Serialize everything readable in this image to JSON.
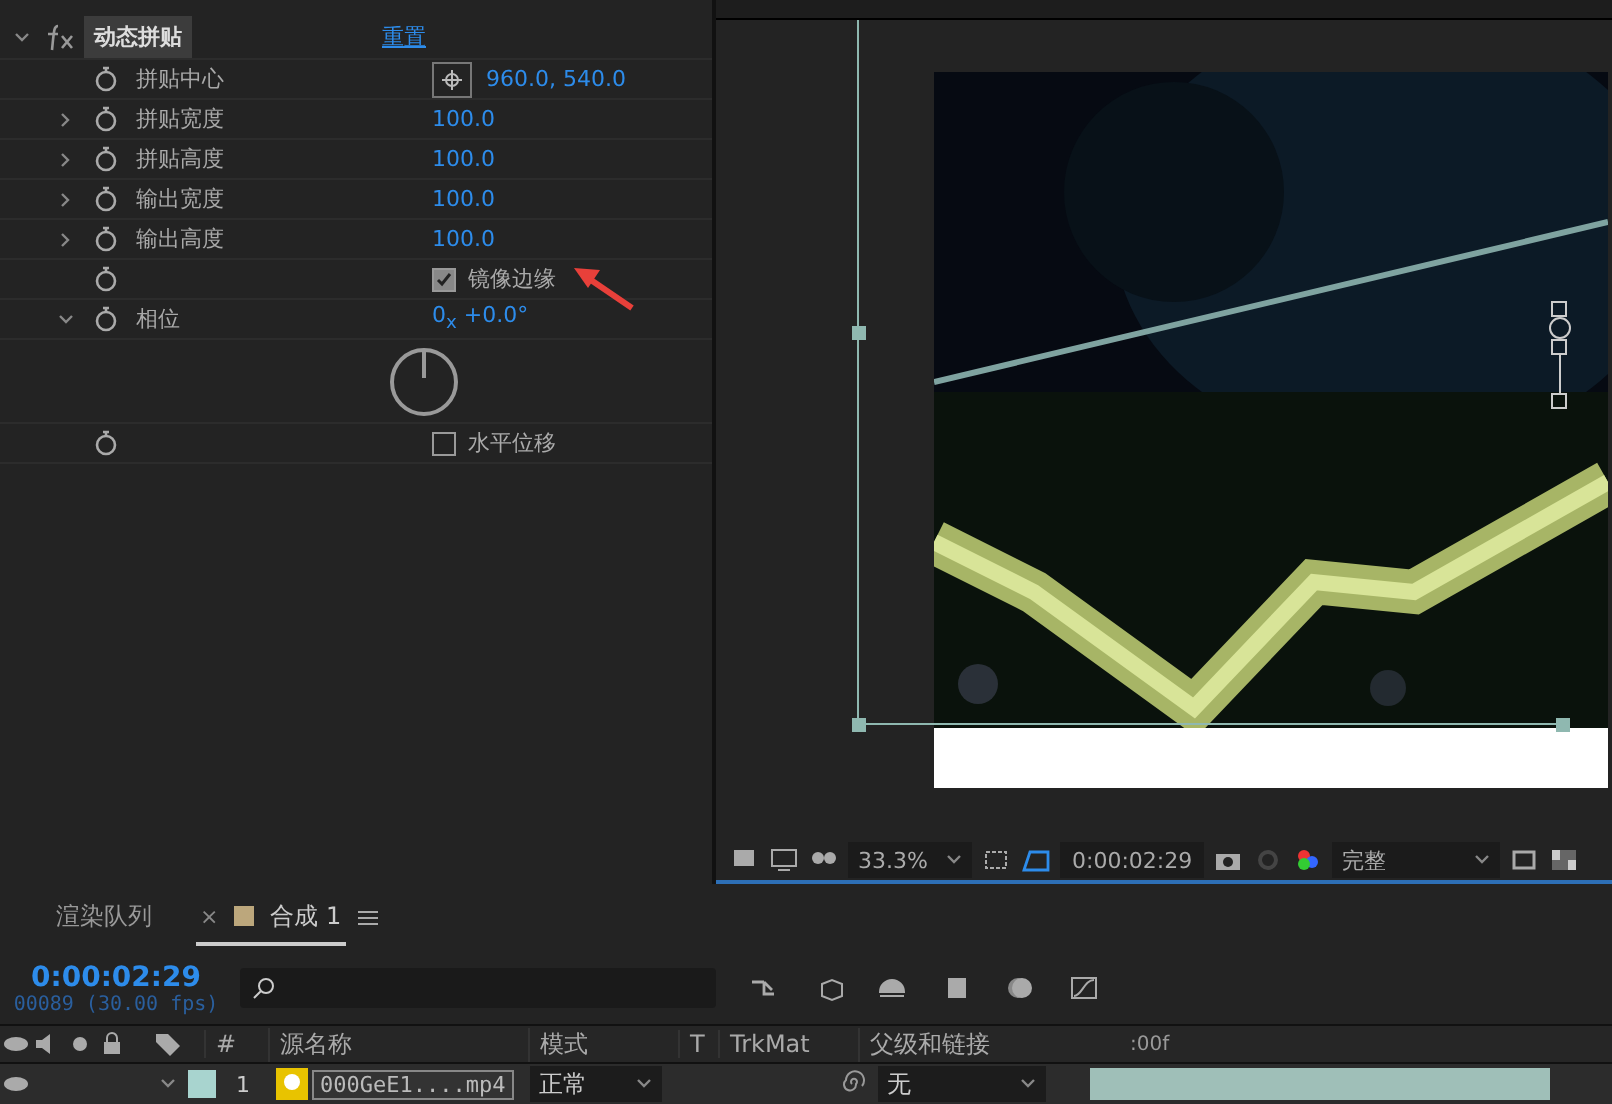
{
  "effect": {
    "name": "动态拼贴",
    "reset": "重置",
    "expanded": true
  },
  "params": [
    {
      "kind": "point",
      "label": "拼贴中心",
      "value": "960.0, 540.0"
    },
    {
      "kind": "number",
      "label": "拼贴宽度",
      "value": "100.0",
      "expanded": false
    },
    {
      "kind": "number",
      "label": "拼贴高度",
      "value": "100.0",
      "expanded": false
    },
    {
      "kind": "number",
      "label": "输出宽度",
      "value": "100.0",
      "expanded": false
    },
    {
      "kind": "number",
      "label": "输出高度",
      "value": "100.0",
      "expanded": false
    },
    {
      "kind": "checkbox",
      "label": "镜像边缘",
      "checked": true
    },
    {
      "kind": "angle",
      "label": "相位",
      "value": "0$_{x}$ +0.0°",
      "expanded": true
    },
    {
      "kind": "checkbox",
      "label": "水平位移",
      "checked": false
    }
  ],
  "viewer": {
    "zoom": "33.3%",
    "time": "0:00:02:29",
    "quality": "完整"
  },
  "timeline": {
    "tabs": [
      {
        "label": "渲染队列",
        "selected": false
      },
      {
        "label": "合成 1",
        "selected": true,
        "close": "×"
      }
    ],
    "timecode": "0:00:02:29",
    "frames": "00089 (30.00 fps)",
    "columns": [
      "#",
      "源名称",
      "模式",
      "T",
      "TrkMat",
      "父级和链接"
    ],
    "ruler": ":00f",
    "layer": {
      "number": "1",
      "name": "000GeE1....mp4",
      "mode": "正常",
      "parent": "无",
      "color": "#a8d4cf"
    }
  }
}
